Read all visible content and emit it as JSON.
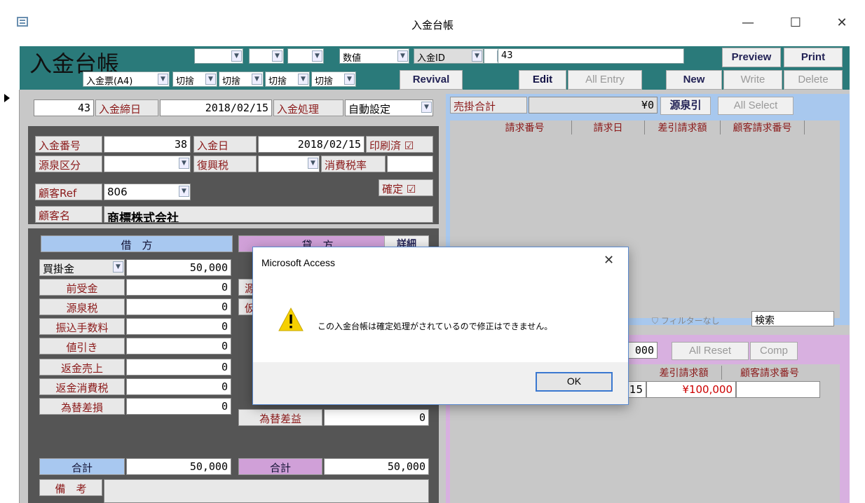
{
  "window": {
    "title": "入金台帳",
    "minimize": "—",
    "maximize": "☐",
    "close": "✕"
  },
  "header": {
    "app_title": "入金台帳",
    "row1": {
      "filter_type": "数値",
      "filter_field": "入金ID",
      "filter_value": "43",
      "preview": "Preview",
      "print": "Print"
    },
    "row2": {
      "report": "入金票(A4)",
      "round1": "切捨",
      "round2": "切捨",
      "round3": "切捨",
      "round4": "切捨",
      "revival": "Revival",
      "edit": "Edit",
      "all_entry": "All Entry",
      "new": "New",
      "write": "Write",
      "delete": "Delete"
    }
  },
  "form": {
    "record_id": "43",
    "close_date_label": "入金締日",
    "close_date": "2018/02/15",
    "process_label": "入金処理",
    "process_value": "自動設定",
    "payment_no_label": "入金番号",
    "payment_no": "38",
    "payment_date_label": "入金日",
    "payment_date": "2018/02/15",
    "printed_label": "印刷済",
    "source_label": "源泉区分",
    "recon_tax_label": "復興税",
    "tax_rate_label": "消費税率",
    "confirmed_label": "確定",
    "customer_ref_label": "顧客Ref",
    "customer_ref": "806",
    "customer_name_label": "顧客名",
    "customer_name": "商標株式会社",
    "debit_header": "借　方",
    "credit_header": "貸　方",
    "detail_btn": "詳細",
    "debit_rows": [
      {
        "label": "買掛金",
        "value": "50,000"
      },
      {
        "label": "前受金",
        "value": "0"
      },
      {
        "label": "源泉税",
        "value": "0"
      },
      {
        "label": "振込手数料",
        "value": "0"
      },
      {
        "label": "値引き",
        "value": "0"
      },
      {
        "label": "返金売上",
        "value": "0"
      },
      {
        "label": "返金消費税",
        "value": "0"
      },
      {
        "label": "為替差損",
        "value": "0"
      }
    ],
    "credit_partial": {
      "row3": "源",
      "row4": "仮"
    },
    "fx_gain_label": "為替差益",
    "fx_gain": "0",
    "debit_total_label": "合計",
    "debit_total": "50,000",
    "credit_total_label": "合計",
    "credit_total": "50,000",
    "remarks_label": "備　考"
  },
  "right": {
    "ar_total_label": "売掛合計",
    "ar_total": "¥0",
    "source_deduct_btn": "源泉引",
    "all_select": "All Select",
    "grid1_headers": [
      "請求番号",
      "請求日",
      "差引請求額",
      "顧客請求番号"
    ],
    "filter_none": "フィルターなし",
    "search": "検索",
    "amount_partial": "000",
    "all_reset": "All Reset",
    "comp": "Comp",
    "grid2_headers": [
      "差引請求額",
      "顧客請求番号"
    ],
    "grid2_row": {
      "date_partial": "15",
      "amount": "¥100,000"
    }
  },
  "dialog": {
    "title": "Microsoft Access",
    "message": "この入金台帳は確定処理がされているので修正はできません。",
    "ok": "OK",
    "close": "✕"
  }
}
